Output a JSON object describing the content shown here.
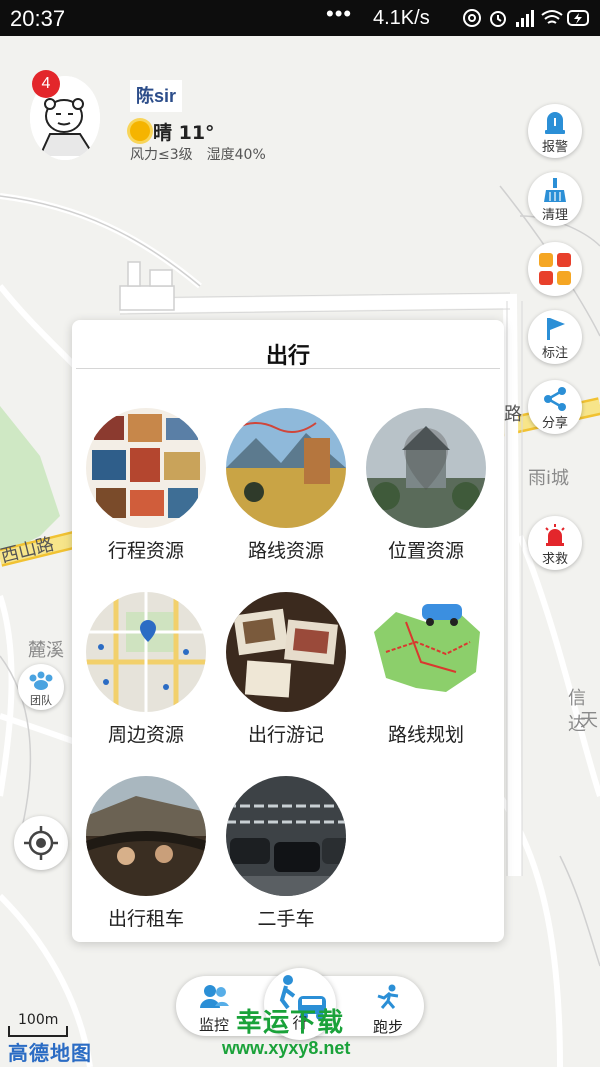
{
  "status_bar": {
    "time": "20:37",
    "more": "•••",
    "network_speed": "4.1K/s",
    "icons": [
      "hotspot-icon",
      "alarm-icon",
      "signal-icon",
      "wifi-icon",
      "battery-charging-icon"
    ]
  },
  "profile": {
    "notification_count": "4",
    "username": "陈sir",
    "weather": "晴 11°",
    "wind": "风力≤3级",
    "humidity": "湿度40%"
  },
  "map_labels": {
    "road_xishan": "西山路",
    "place_luxi": "麓溪",
    "place_yucheng": "雨i城",
    "place_xinda": "信达",
    "place_tian": "天",
    "edge_road": "路"
  },
  "right_buttons": [
    {
      "label": "报警",
      "icon": "alarm-bell-icon"
    },
    {
      "label": "清理",
      "icon": "broom-icon"
    },
    {
      "label": "",
      "icon": "apps-grid-icon"
    },
    {
      "label": "标注",
      "icon": "flag-icon"
    },
    {
      "label": "分享",
      "icon": "share-icon"
    },
    {
      "label": "求救",
      "icon": "siren-icon"
    }
  ],
  "left_buttons": {
    "team_label": "团队",
    "locate_icon": "locate-icon"
  },
  "panel": {
    "title": "出行",
    "tiles": [
      {
        "label": "行程资源"
      },
      {
        "label": "路线资源"
      },
      {
        "label": "位置资源"
      },
      {
        "label": "周边资源"
      },
      {
        "label": "出行游记"
      },
      {
        "label": "路线规划"
      },
      {
        "label": "出行租车"
      },
      {
        "label": "二手车"
      }
    ]
  },
  "bottom_bar": {
    "left_label": "监控",
    "center_label": "行",
    "right_label": "跑步"
  },
  "map_footer": {
    "scale": "100m",
    "logo": "高德地图"
  },
  "watermark": {
    "text": "幸运下载",
    "url": "www.xyxy8.net"
  },
  "colors": {
    "accent_blue": "#2b8fd6",
    "alert_red": "#e3262b",
    "watermark_green": "#1aa23a",
    "road_yellow": "#f7d23a"
  }
}
